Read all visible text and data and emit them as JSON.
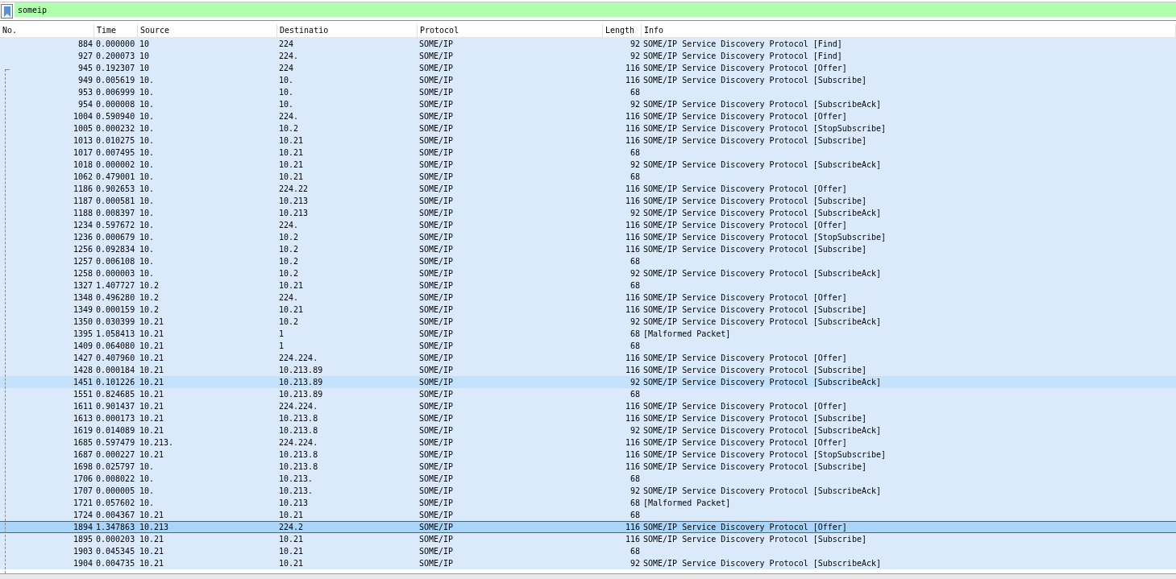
{
  "filter": {
    "value": "someip"
  },
  "table": {
    "columns": [
      "No.",
      "Time",
      "Source",
      "Destinatio",
      "Protocol",
      "Length",
      "Info"
    ],
    "rows": [
      {
        "no": "884",
        "time": "0.000000",
        "source": "10",
        "destination": "224",
        "protocol": "SOME/IP",
        "length": "92",
        "info": "SOME/IP Service Discovery Protocol [Find]",
        "selected": false,
        "hovered": false
      },
      {
        "no": "927",
        "time": "0.200073",
        "source": "10",
        "destination": "224.",
        "protocol": "SOME/IP",
        "length": "92",
        "info": "SOME/IP Service Discovery Protocol [Find]",
        "selected": false,
        "hovered": false
      },
      {
        "no": "945",
        "time": "0.192307",
        "source": "10",
        "destination": "224",
        "protocol": "SOME/IP",
        "length": "116",
        "info": "SOME/IP Service Discovery Protocol [Offer]",
        "selected": false,
        "hovered": false
      },
      {
        "no": "949",
        "time": "0.005619",
        "source": "10.",
        "destination": "10.",
        "protocol": "SOME/IP",
        "length": "116",
        "info": "SOME/IP Service Discovery Protocol [Subscribe]",
        "selected": false,
        "hovered": false
      },
      {
        "no": "953",
        "time": "0.006999",
        "source": "10.",
        "destination": "10.",
        "protocol": "SOME/IP",
        "length": "68",
        "selected": false,
        "hovered": false
      },
      {
        "no": "954",
        "time": "0.000008",
        "source": "10.",
        "destination": "10.",
        "protocol": "SOME/IP",
        "length": "92",
        "info": "SOME/IP Service Discovery Protocol [SubscribeAck]",
        "selected": false,
        "hovered": false
      },
      {
        "no": "1004",
        "time": "0.590940",
        "source": "10.",
        "destination": "224.",
        "protocol": "SOME/IP",
        "length": "116",
        "info": "SOME/IP Service Discovery Protocol [Offer]",
        "selected": false,
        "hovered": false
      },
      {
        "no": "1005",
        "time": "0.000232",
        "source": "10.",
        "destination": "10.2",
        "protocol": "SOME/IP",
        "length": "116",
        "info": "SOME/IP Service Discovery Protocol [StopSubscribe]",
        "selected": false,
        "hovered": false
      },
      {
        "no": "1013",
        "time": "0.010275",
        "source": "10.",
        "destination": "10.21",
        "protocol": "SOME/IP",
        "length": "116",
        "info": "SOME/IP Service Discovery Protocol [Subscribe]",
        "selected": false,
        "hovered": false
      },
      {
        "no": "1017",
        "time": "0.007495",
        "source": "10.",
        "destination": "10.21",
        "protocol": "SOME/IP",
        "length": "68",
        "selected": false,
        "hovered": false
      },
      {
        "no": "1018",
        "time": "0.000002",
        "source": "10.",
        "destination": "10.21",
        "protocol": "SOME/IP",
        "length": "92",
        "info": "SOME/IP Service Discovery Protocol [SubscribeAck]",
        "selected": false,
        "hovered": false
      },
      {
        "no": "1062",
        "time": "0.479001",
        "source": "10.",
        "destination": "10.21",
        "protocol": "SOME/IP",
        "length": "68",
        "selected": false,
        "hovered": false
      },
      {
        "no": "1186",
        "time": "0.902653",
        "source": "10.",
        "destination": "224.22",
        "protocol": "SOME/IP",
        "length": "116",
        "info": "SOME/IP Service Discovery Protocol [Offer]",
        "selected": false,
        "hovered": false
      },
      {
        "no": "1187",
        "time": "0.000581",
        "source": "10.",
        "destination": "10.213",
        "protocol": "SOME/IP",
        "length": "116",
        "info": "SOME/IP Service Discovery Protocol [Subscribe]",
        "selected": false,
        "hovered": false
      },
      {
        "no": "1188",
        "time": "0.008397",
        "source": "10.",
        "destination": "10.213",
        "protocol": "SOME/IP",
        "length": "92",
        "info": "SOME/IP Service Discovery Protocol [SubscribeAck]",
        "selected": false,
        "hovered": false
      },
      {
        "no": "1234",
        "time": "0.597672",
        "source": "10.",
        "destination": "224.",
        "protocol": "SOME/IP",
        "length": "116",
        "info": "SOME/IP Service Discovery Protocol [Offer]",
        "selected": false,
        "hovered": false
      },
      {
        "no": "1236",
        "time": "0.000679",
        "source": "10.",
        "destination": "10.2",
        "protocol": "SOME/IP",
        "length": "116",
        "info": "SOME/IP Service Discovery Protocol [StopSubscribe]",
        "selected": false,
        "hovered": false
      },
      {
        "no": "1256",
        "time": "0.092834",
        "source": "10.",
        "destination": "10.2",
        "protocol": "SOME/IP",
        "length": "116",
        "info": "SOME/IP Service Discovery Protocol [Subscribe]",
        "selected": false,
        "hovered": false
      },
      {
        "no": "1257",
        "time": "0.006108",
        "source": "10.",
        "destination": "10.2",
        "protocol": "SOME/IP",
        "length": "68",
        "selected": false,
        "hovered": false
      },
      {
        "no": "1258",
        "time": "0.000003",
        "source": "10.",
        "destination": "10.2",
        "protocol": "SOME/IP",
        "length": "92",
        "info": "SOME/IP Service Discovery Protocol [SubscribeAck]",
        "selected": false,
        "hovered": false
      },
      {
        "no": "1327",
        "time": "1.407727",
        "source": "10.2",
        "destination": "10.21",
        "protocol": "SOME/IP",
        "length": "68",
        "selected": false,
        "hovered": false
      },
      {
        "no": "1348",
        "time": "0.496280",
        "source": "10.2",
        "destination": "224.",
        "protocol": "SOME/IP",
        "length": "116",
        "info": "SOME/IP Service Discovery Protocol [Offer]",
        "selected": false,
        "hovered": false
      },
      {
        "no": "1349",
        "time": "0.000159",
        "source": "10.2",
        "destination": "10.21",
        "protocol": "SOME/IP",
        "length": "116",
        "info": "SOME/IP Service Discovery Protocol [Subscribe]",
        "selected": false,
        "hovered": false
      },
      {
        "no": "1350",
        "time": "0.030399",
        "source": "10.21",
        "destination": "10.2",
        "protocol": "SOME/IP",
        "length": "92",
        "info": "SOME/IP Service Discovery Protocol [SubscribeAck]",
        "selected": false,
        "hovered": false
      },
      {
        "no": "1395",
        "time": "1.058413",
        "source": "10.21",
        "destination": "1",
        "protocol": "SOME/IP",
        "length": "68",
        "info": "[Malformed Packet]",
        "selected": false,
        "hovered": false
      },
      {
        "no": "1409",
        "time": "0.064080",
        "source": "10.21",
        "destination": "1",
        "protocol": "SOME/IP",
        "length": "68",
        "selected": false,
        "hovered": false
      },
      {
        "no": "1427",
        "time": "0.407960",
        "source": "10.21",
        "destination": "224.224.",
        "protocol": "SOME/IP",
        "length": "116",
        "info": "SOME/IP Service Discovery Protocol [Offer]",
        "selected": false,
        "hovered": false
      },
      {
        "no": "1428",
        "time": "0.000184",
        "source": "10.21",
        "destination": "10.213.89",
        "protocol": "SOME/IP",
        "length": "116",
        "info": "SOME/IP Service Discovery Protocol [Subscribe]",
        "selected": false,
        "hovered": false
      },
      {
        "no": "1451",
        "time": "0.101226",
        "source": "10.21",
        "destination": "10.213.89",
        "protocol": "SOME/IP",
        "length": "92",
        "info": "SOME/IP Service Discovery Protocol [SubscribeAck]",
        "selected": false,
        "hovered": true
      },
      {
        "no": "1551",
        "time": "0.824685",
        "source": "10.21",
        "destination": "10.213.89",
        "protocol": "SOME/IP",
        "length": "68",
        "selected": false,
        "hovered": false
      },
      {
        "no": "1611",
        "time": "0.901437",
        "source": "10.21",
        "destination": "224.224.",
        "protocol": "SOME/IP",
        "length": "116",
        "info": "SOME/IP Service Discovery Protocol [Offer]",
        "selected": false,
        "hovered": false
      },
      {
        "no": "1613",
        "time": "0.000173",
        "source": "10.21",
        "destination": "10.213.8",
        "protocol": "SOME/IP",
        "length": "116",
        "info": "SOME/IP Service Discovery Protocol [Subscribe]",
        "selected": false,
        "hovered": false
      },
      {
        "no": "1619",
        "time": "0.014089",
        "source": "10.21",
        "destination": "10.213.8",
        "protocol": "SOME/IP",
        "length": "92",
        "info": "SOME/IP Service Discovery Protocol [SubscribeAck]",
        "selected": false,
        "hovered": false
      },
      {
        "no": "1685",
        "time": "0.597479",
        "source": "10.213.",
        "destination": "224.224.",
        "protocol": "SOME/IP",
        "length": "116",
        "info": "SOME/IP Service Discovery Protocol [Offer]",
        "selected": false,
        "hovered": false
      },
      {
        "no": "1687",
        "time": "0.000227",
        "source": "10.21",
        "destination": "10.213.8",
        "protocol": "SOME/IP",
        "length": "116",
        "info": "SOME/IP Service Discovery Protocol [StopSubscribe]",
        "selected": false,
        "hovered": false
      },
      {
        "no": "1698",
        "time": "0.025797",
        "source": "10.",
        "destination": "10.213.8",
        "protocol": "SOME/IP",
        "length": "116",
        "info": "SOME/IP Service Discovery Protocol [Subscribe]",
        "selected": false,
        "hovered": false
      },
      {
        "no": "1706",
        "time": "0.008022",
        "source": "10.",
        "destination": "10.213.",
        "protocol": "SOME/IP",
        "length": "68",
        "selected": false,
        "hovered": false
      },
      {
        "no": "1707",
        "time": "0.000005",
        "source": "10.",
        "destination": "10.213.",
        "protocol": "SOME/IP",
        "length": "92",
        "info": "SOME/IP Service Discovery Protocol [SubscribeAck]",
        "selected": false,
        "hovered": false
      },
      {
        "no": "1721",
        "time": "0.057602",
        "source": "10.",
        "destination": "10.213",
        "protocol": "SOME/IP",
        "length": "68",
        "info": "[Malformed Packet]",
        "selected": false,
        "hovered": false
      },
      {
        "no": "1724",
        "time": "0.004367",
        "source": "10.21",
        "destination": "10.21",
        "protocol": "SOME/IP",
        "length": "68",
        "selected": false,
        "hovered": false
      },
      {
        "no": "1894",
        "time": "1.347863",
        "source": "10.213",
        "destination": "224.2",
        "protocol": "SOME/IP",
        "length": "116",
        "info": "SOME/IP Service Discovery Protocol [Offer]",
        "selected": true,
        "hovered": false
      },
      {
        "no": "1895",
        "time": "0.000203",
        "source": "10.21",
        "destination": "10.21",
        "protocol": "SOME/IP",
        "length": "116",
        "info": "SOME/IP Service Discovery Protocol [Subscribe]",
        "selected": false,
        "hovered": false
      },
      {
        "no": "1903",
        "time": "0.045345",
        "source": "10.21",
        "destination": "10.21",
        "protocol": "SOME/IP",
        "length": "68",
        "selected": false,
        "hovered": false
      },
      {
        "no": "1904",
        "time": "0.004735",
        "source": "10.21",
        "destination": "10.21",
        "protocol": "SOME/IP",
        "length": "92",
        "info": "SOME/IP Service Discovery Protocol [SubscribeAck]",
        "selected": false,
        "hovered": false
      }
    ]
  }
}
